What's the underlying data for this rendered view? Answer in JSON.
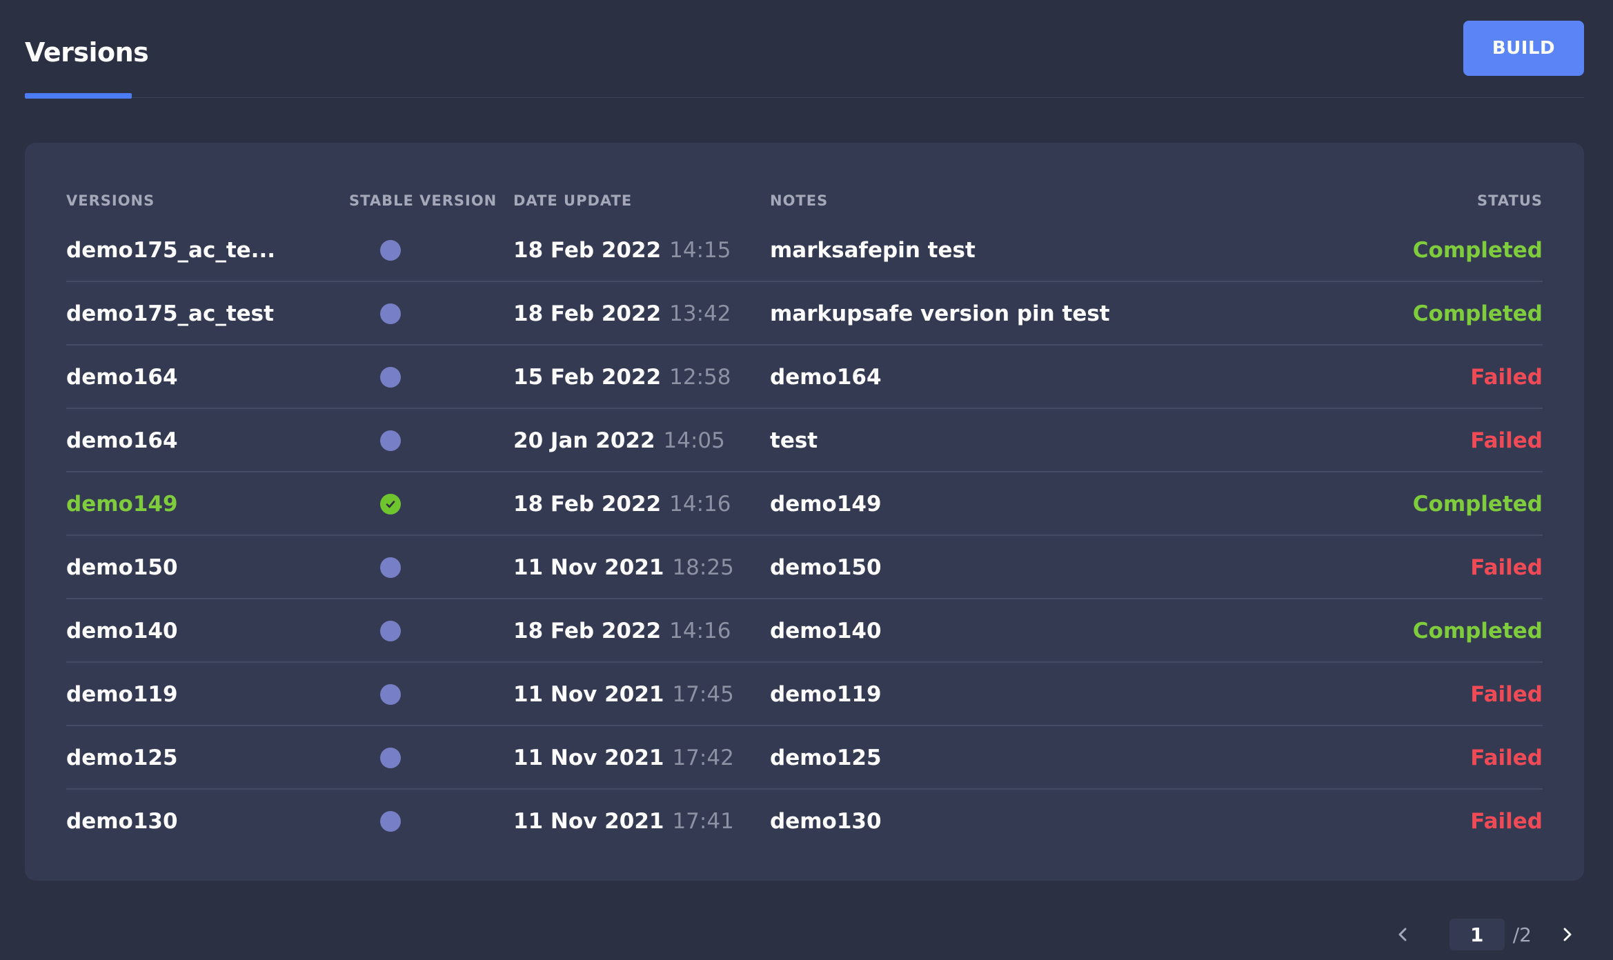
{
  "header": {
    "tab_label": "Versions",
    "build_label": "BUILD"
  },
  "table": {
    "columns": {
      "versions": "VERSIONS",
      "stable": "STABLE VERSION",
      "date": "DATE UPDATE",
      "notes": "NOTES",
      "status": "STATUS"
    },
    "rows": [
      {
        "version": "demo175_ac_te...",
        "stable": false,
        "date": "18 Feb 2022",
        "time": "14:15",
        "notes": "marksafepin test",
        "status": "Completed"
      },
      {
        "version": "demo175_ac_test",
        "stable": false,
        "date": "18 Feb 2022",
        "time": "13:42",
        "notes": "markupsafe version pin test",
        "status": "Completed"
      },
      {
        "version": "demo164",
        "stable": false,
        "date": "15 Feb 2022",
        "time": "12:58",
        "notes": "demo164",
        "status": "Failed"
      },
      {
        "version": "demo164",
        "stable": false,
        "date": "20 Jan 2022",
        "time": "14:05",
        "notes": "test",
        "status": "Failed"
      },
      {
        "version": "demo149",
        "stable": true,
        "date": "18 Feb 2022",
        "time": "14:16",
        "notes": "demo149",
        "status": "Completed"
      },
      {
        "version": "demo150",
        "stable": false,
        "date": "11 Nov 2021",
        "time": "18:25",
        "notes": "demo150",
        "status": "Failed"
      },
      {
        "version": "demo140",
        "stable": false,
        "date": "18 Feb 2022",
        "time": "14:16",
        "notes": "demo140",
        "status": "Completed"
      },
      {
        "version": "demo119",
        "stable": false,
        "date": "11 Nov 2021",
        "time": "17:45",
        "notes": "demo119",
        "status": "Failed"
      },
      {
        "version": "demo125",
        "stable": false,
        "date": "11 Nov 2021",
        "time": "17:42",
        "notes": "demo125",
        "status": "Failed"
      },
      {
        "version": "demo130",
        "stable": false,
        "date": "11 Nov 2021",
        "time": "17:41",
        "notes": "demo130",
        "status": "Failed"
      }
    ]
  },
  "pagination": {
    "current": "1",
    "total": "/2",
    "prev_icon": "chevron-left-icon",
    "next_icon": "chevron-right-icon"
  },
  "colors": {
    "background": "#2b3042",
    "card": "#353a53",
    "accent": "#5b85f7",
    "completed": "#7fcd3c",
    "failed": "#ef4b57",
    "stable_dot": "#7780c6"
  }
}
